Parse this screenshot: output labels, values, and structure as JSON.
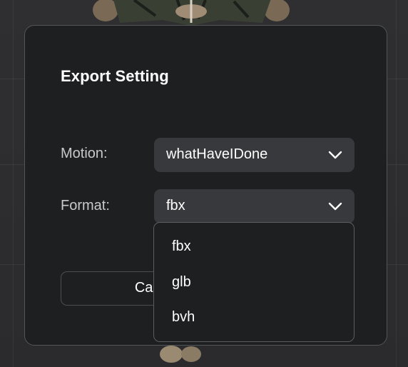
{
  "dialog": {
    "title": "Export Setting",
    "motion": {
      "label": "Motion:",
      "value": "whatHaveIDone"
    },
    "format": {
      "label": "Format:",
      "value": "fbx",
      "options": [
        "fbx",
        "glb",
        "bvh"
      ],
      "expanded": true
    },
    "cancel_label": "Cancel"
  },
  "icons": {
    "motion_select": "chevron-down-icon",
    "format_select": "chevron-down-icon"
  },
  "colors": {
    "dialog_bg": "#1e1f21",
    "select_bg": "#38393c",
    "dialog_border": "#545558",
    "text_primary": "#ffffff",
    "text_label": "#c9c9cc"
  }
}
